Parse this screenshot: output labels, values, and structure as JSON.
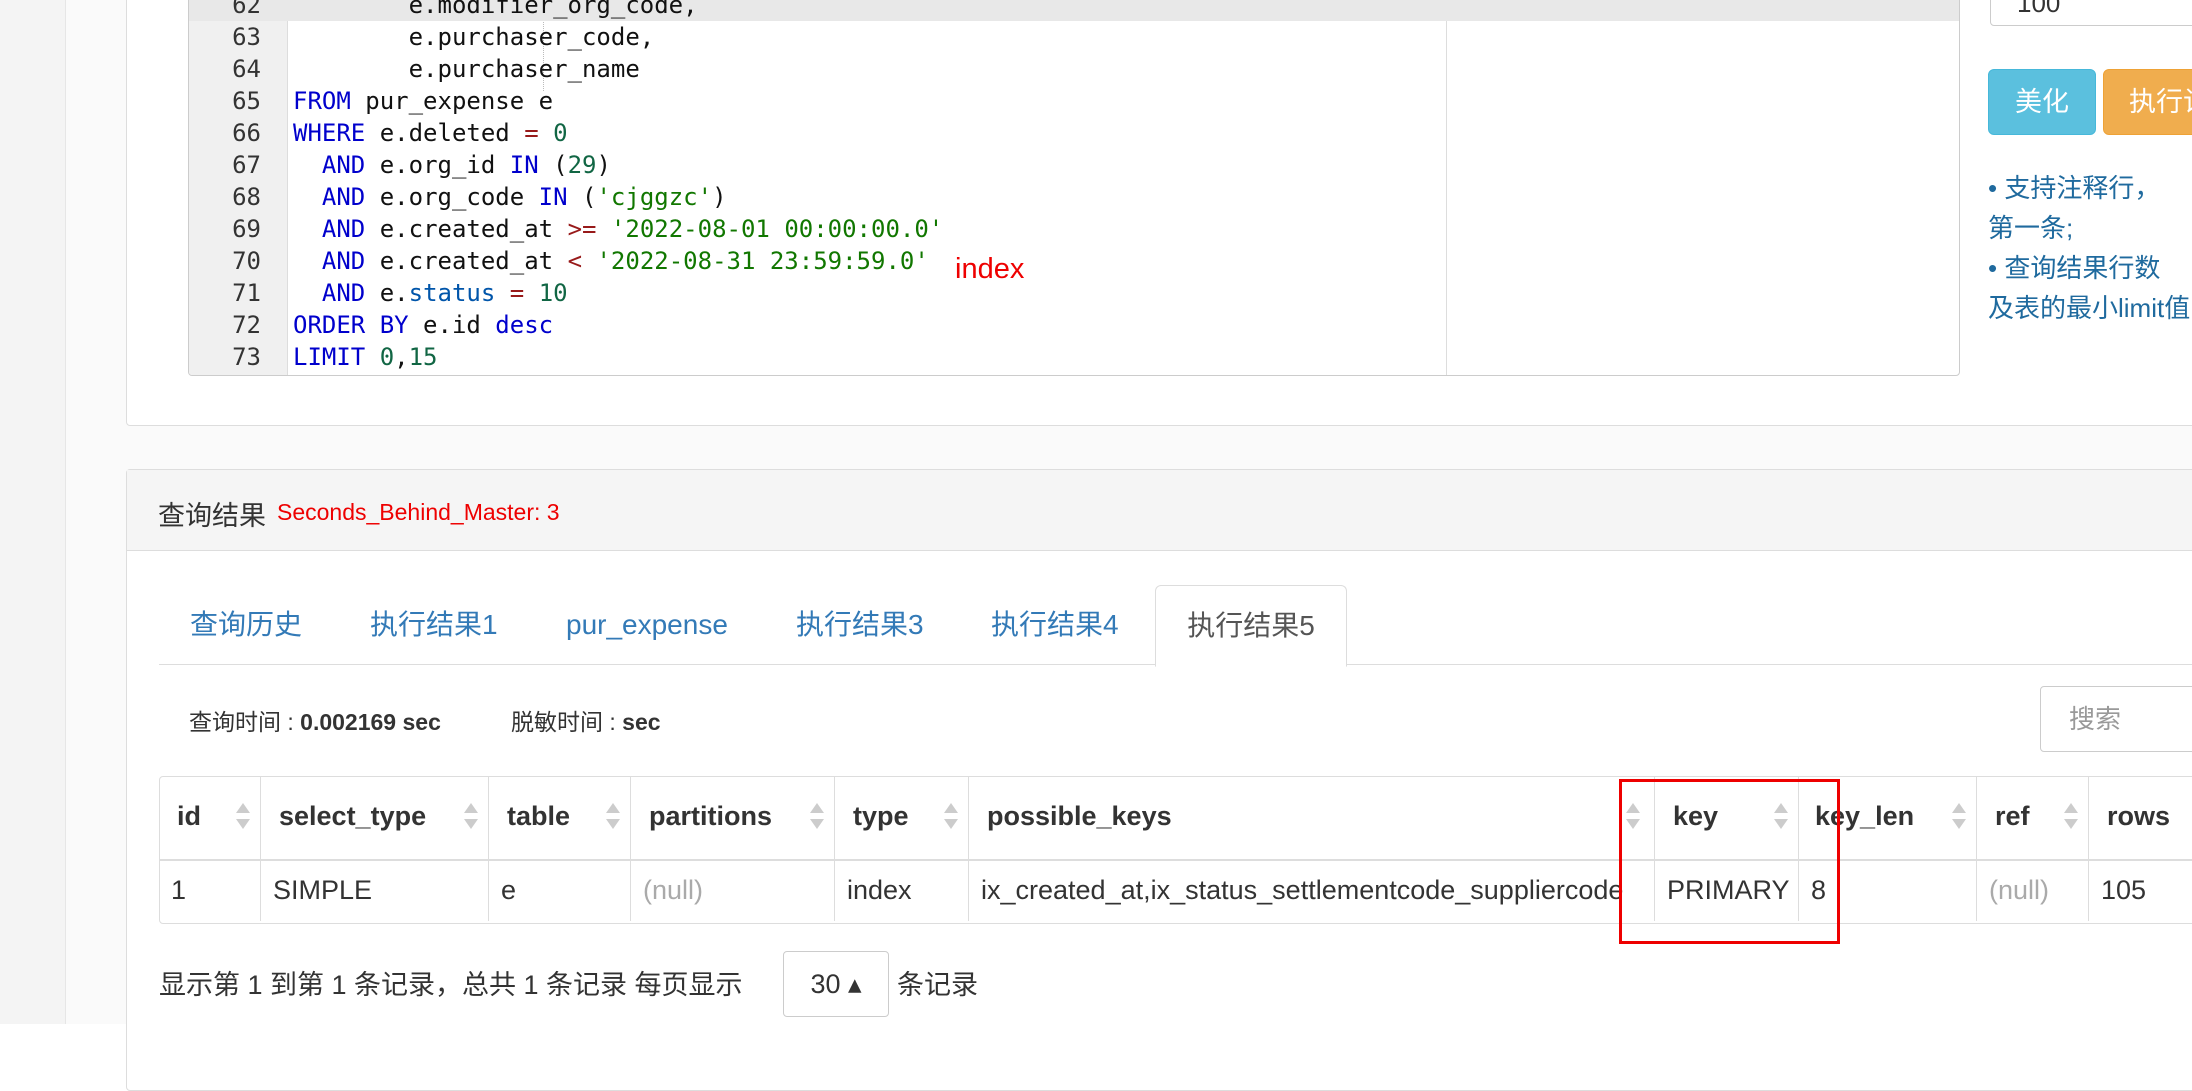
{
  "editor": {
    "lines": [
      {
        "n": "62",
        "parts": [
          [
            "",
            "        e.modifier_org_code,"
          ]
        ]
      },
      {
        "n": "63",
        "parts": [
          [
            "",
            "        e.purchaser_code,"
          ]
        ]
      },
      {
        "n": "64",
        "parts": [
          [
            "",
            "        e.purchaser_name"
          ]
        ]
      },
      {
        "n": "65",
        "parts": [
          [
            "kw",
            "FROM"
          ],
          [
            "",
            " pur_expense e"
          ]
        ]
      },
      {
        "n": "66",
        "parts": [
          [
            "kw",
            "WHERE"
          ],
          [
            "",
            " e.deleted "
          ],
          [
            "op",
            "="
          ],
          [
            "",
            " "
          ],
          [
            "num",
            "0"
          ]
        ]
      },
      {
        "n": "67",
        "parts": [
          [
            "",
            "  "
          ],
          [
            "kw",
            "AND"
          ],
          [
            "",
            " e.org_id "
          ],
          [
            "kw",
            "IN"
          ],
          [
            "",
            " ("
          ],
          [
            "num",
            "29"
          ],
          [
            "",
            ")"
          ]
        ]
      },
      {
        "n": "68",
        "parts": [
          [
            "",
            "  "
          ],
          [
            "kw",
            "AND"
          ],
          [
            "",
            " e.org_code "
          ],
          [
            "kw",
            "IN"
          ],
          [
            "",
            " ("
          ],
          [
            "str",
            "'cjggzc'"
          ],
          [
            "",
            ")"
          ]
        ]
      },
      {
        "n": "69",
        "parts": [
          [
            "",
            "  "
          ],
          [
            "kw",
            "AND"
          ],
          [
            "",
            " e.created_at "
          ],
          [
            "op",
            ">="
          ],
          [
            "",
            " "
          ],
          [
            "str",
            "'2022-08-01 00:00:00.0'"
          ]
        ]
      },
      {
        "n": "70",
        "parts": [
          [
            "",
            "  "
          ],
          [
            "kw",
            "AND"
          ],
          [
            "",
            " e.created_at "
          ],
          [
            "op",
            "<"
          ],
          [
            "",
            " "
          ],
          [
            "str",
            "'2022-08-31 23:59:59.0'"
          ]
        ]
      },
      {
        "n": "71",
        "parts": [
          [
            "",
            "  "
          ],
          [
            "kw",
            "AND"
          ],
          [
            "",
            " e."
          ],
          [
            "var",
            "status"
          ],
          [
            "",
            " "
          ],
          [
            "op",
            "="
          ],
          [
            "",
            " "
          ],
          [
            "num",
            "10"
          ]
        ]
      },
      {
        "n": "72",
        "parts": [
          [
            "kw",
            "ORDER BY"
          ],
          [
            "",
            " e.id "
          ],
          [
            "kw",
            "desc"
          ]
        ]
      },
      {
        "n": "73",
        "parts": [
          [
            "kw",
            "LIMIT"
          ],
          [
            "",
            " "
          ],
          [
            "num",
            "0"
          ],
          [
            "",
            ","
          ],
          [
            "num",
            "15"
          ]
        ]
      }
    ],
    "annotation": "index"
  },
  "controls": {
    "limit_value": "100",
    "beautify_label": "美化",
    "execute_label": "执行计",
    "tip1_line1": "•   支持注释行，",
    "tip1_line2": "第一条;",
    "tip2_line1": "•   查询结果行数",
    "tip2_line2": "及表的最小limit值"
  },
  "results": {
    "title": "查询结果",
    "seconds_behind": "Seconds_Behind_Master: 3",
    "tabs": [
      "查询历史",
      "执行结果1",
      "pur_expense",
      "执行结果3",
      "执行结果4",
      "执行结果5"
    ],
    "active_tab": "执行结果5",
    "query_time_label": "查询时间 : ",
    "query_time_value": "0.002169 sec",
    "mask_time_label": "脱敏时间 : ",
    "mask_time_value": "sec",
    "search_placeholder": "搜索",
    "columns": [
      "id",
      "select_type",
      "table",
      "partitions",
      "type",
      "possible_keys",
      "key",
      "key_len",
      "ref",
      "rows"
    ],
    "rows": [
      [
        "1",
        "SIMPLE",
        "e",
        "(null)",
        "index",
        "ix_created_at,ix_status_settlementcode_suppliercode",
        "PRIMARY",
        "8",
        "(null)",
        "105"
      ]
    ],
    "pager_prefix": "显示第 1 到第 1 条记录，总共 1 条记录  每页显示",
    "page_size": "30 ▴",
    "pager_suffix": "条记录"
  },
  "colors": {
    "keyword": "#0000cc",
    "string": "#117700",
    "number": "#116644",
    "link": "#337ab7",
    "highlight_box": "#ee0000",
    "beautify_button": "#5bc0de",
    "execute_button": "#f0ad4e"
  }
}
